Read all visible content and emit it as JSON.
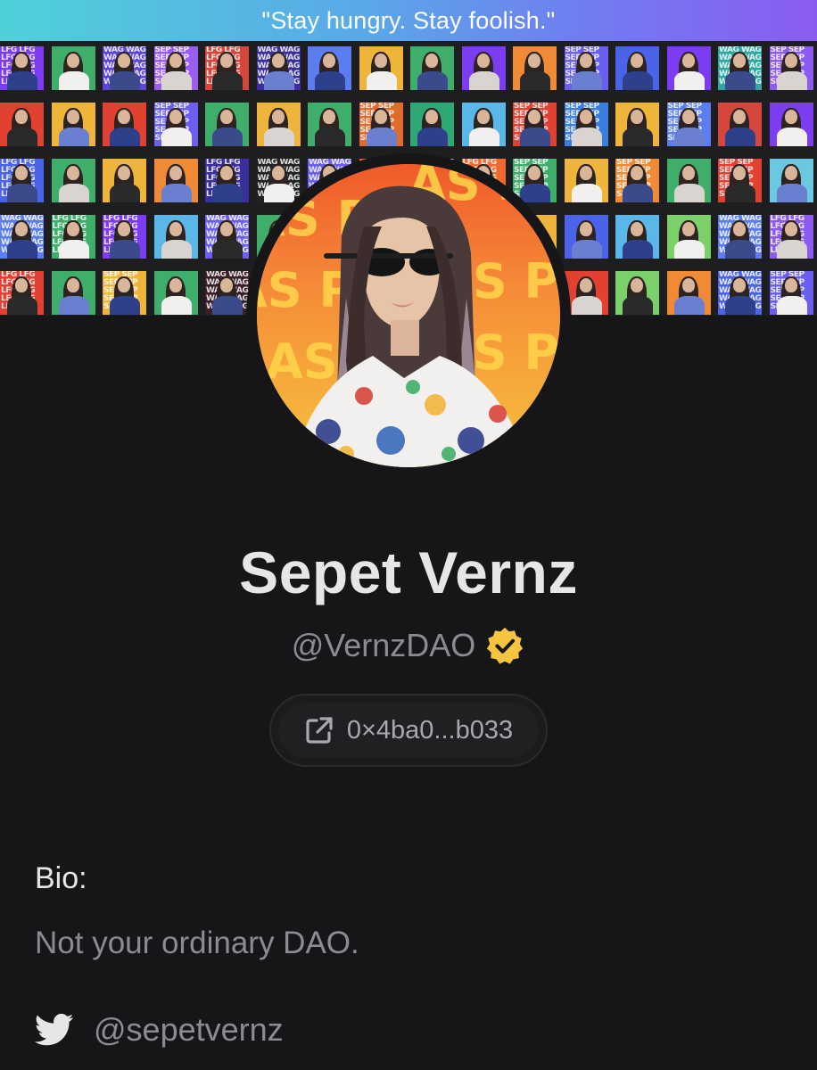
{
  "banner": {
    "quote": "\"Stay hungry. Stay foolish.\""
  },
  "cover": {
    "tiles": [
      {
        "c": "#7b3cf2",
        "t": "LFG"
      },
      {
        "c": "#3fae6a",
        "t": ""
      },
      {
        "c": "#5a46d8",
        "t": "WAG"
      },
      {
        "c": "#9b5cf0",
        "t": "SEP"
      },
      {
        "c": "#d5473c",
        "t": "LFG"
      },
      {
        "c": "#3b2fa0",
        "t": "WAG"
      },
      {
        "c": "#5b7df0",
        "t": ""
      },
      {
        "c": "#efb53a",
        "t": ""
      },
      {
        "c": "#3fae6a",
        "t": ""
      },
      {
        "c": "#7b3cf2",
        "t": ""
      },
      {
        "c": "#f08a34",
        "t": ""
      },
      {
        "c": "#6a5ff0",
        "t": "SEP"
      },
      {
        "c": "#4a63e8",
        "t": ""
      },
      {
        "c": "#7b3cf2",
        "t": ""
      },
      {
        "c": "#2ea8a0",
        "t": "WAG"
      },
      {
        "c": "#8d5bf1",
        "t": "SEP"
      },
      {
        "c": "#e24030",
        "t": ""
      },
      {
        "c": "#efb53a",
        "t": ""
      },
      {
        "c": "#e24030",
        "t": ""
      },
      {
        "c": "#6a5ff0",
        "t": "SEP"
      },
      {
        "c": "#3fae6a",
        "t": ""
      },
      {
        "c": "#efb53a",
        "t": ""
      },
      {
        "c": "#3fae6a",
        "t": ""
      },
      {
        "c": "#e06b2c",
        "t": "SEP"
      },
      {
        "c": "#2ea874",
        "t": ""
      },
      {
        "c": "#5ab8e8",
        "t": ""
      },
      {
        "c": "#e24030",
        "t": "SEP"
      },
      {
        "c": "#3b7ee0",
        "t": "SEP"
      },
      {
        "c": "#efb53a",
        "t": ""
      },
      {
        "c": "#5b7df0",
        "t": "SEP"
      },
      {
        "c": "#d5473c",
        "t": ""
      },
      {
        "c": "#7b3cf2",
        "t": ""
      },
      {
        "c": "#4a63e8",
        "t": "LFG"
      },
      {
        "c": "#3fae6a",
        "t": ""
      },
      {
        "c": "#efb53a",
        "t": ""
      },
      {
        "c": "#f08a34",
        "t": ""
      },
      {
        "c": "#3b2fa0",
        "t": "LFG"
      },
      {
        "c": "#222222",
        "t": "WAG"
      },
      {
        "c": "#6a5ff0",
        "t": "WAG"
      },
      {
        "c": "#f05a2a",
        "t": ""
      },
      {
        "c": "#e24030",
        "t": "WAG"
      },
      {
        "c": "#f06a30",
        "t": "LFG"
      },
      {
        "c": "#3fae6a",
        "t": "SEP"
      },
      {
        "c": "#efb53a",
        "t": ""
      },
      {
        "c": "#f08a34",
        "t": "SEP"
      },
      {
        "c": "#3fae6a",
        "t": ""
      },
      {
        "c": "#e24030",
        "t": "SEP"
      },
      {
        "c": "#6ac8e0",
        "t": ""
      },
      {
        "c": "#5b7df0",
        "t": "WAG"
      },
      {
        "c": "#3fae6a",
        "t": "LFG"
      },
      {
        "c": "#7b3cf2",
        "t": "LFG"
      },
      {
        "c": "#5ab8e8",
        "t": ""
      },
      {
        "c": "#6a5ff0",
        "t": "WAG"
      },
      {
        "c": "#3fae6a",
        "t": ""
      },
      {
        "c": "#f05a2a",
        "t": ""
      },
      {
        "c": "#f6c43e",
        "t": ""
      },
      {
        "c": "#9b5cf0",
        "t": ""
      },
      {
        "c": "#3fae6a",
        "t": ""
      },
      {
        "c": "#efb53a",
        "t": ""
      },
      {
        "c": "#4a63e8",
        "t": ""
      },
      {
        "c": "#5ab8e8",
        "t": ""
      },
      {
        "c": "#7bd06a",
        "t": ""
      },
      {
        "c": "#5b7df0",
        "t": "WAG"
      },
      {
        "c": "#8d5bf1",
        "t": "LFG"
      },
      {
        "c": "#e24030",
        "t": "LFG"
      },
      {
        "c": "#3fae6a",
        "t": ""
      },
      {
        "c": "#efb53a",
        "t": "SEP"
      },
      {
        "c": "#3fae6a",
        "t": ""
      },
      {
        "c": "#3a1e2a",
        "t": "WAG"
      },
      {
        "c": "#efb53a",
        "t": ""
      },
      {
        "c": "#f06a30",
        "t": "LFG"
      },
      {
        "c": "#f05a2a",
        "t": ""
      },
      {
        "c": "#3fae6a",
        "t": ""
      },
      {
        "c": "#4a63e8",
        "t": ""
      },
      {
        "c": "#3fae6a",
        "t": ""
      },
      {
        "c": "#e24030",
        "t": ""
      },
      {
        "c": "#7bd06a",
        "t": ""
      },
      {
        "c": "#f08a34",
        "t": ""
      },
      {
        "c": "#4a63e8",
        "t": "WAG"
      },
      {
        "c": "#6a5ff0",
        "t": "SEP"
      }
    ]
  },
  "profile": {
    "avatar_text": "AS PE",
    "name": "Sepet Vernz",
    "handle": "@VernzDAO",
    "verified_color": "#f5c542",
    "wallet_address": "0×4ba0...b033",
    "wallet_icon": "external-link-icon"
  },
  "bio": {
    "label": "Bio:",
    "text": "Not your ordinary DAO."
  },
  "social": {
    "twitter_icon": "twitter-icon",
    "twitter_handle": "@sepetvernz"
  }
}
